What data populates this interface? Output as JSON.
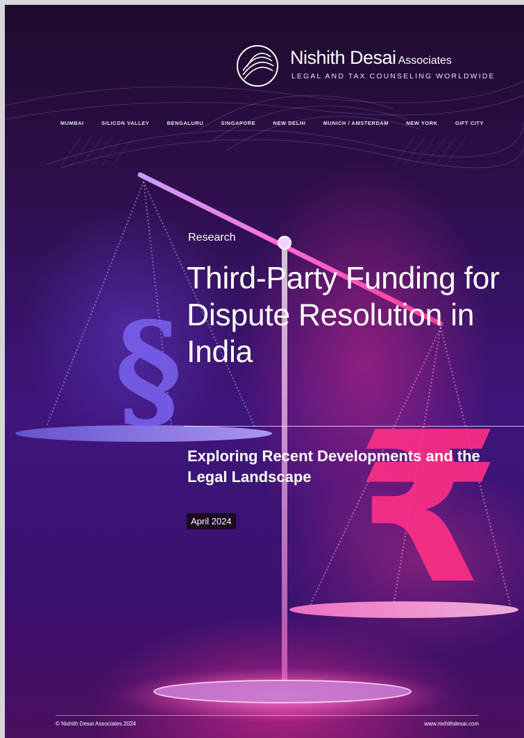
{
  "brand": {
    "name": "Nishith Desai",
    "name_suffix": "Associates",
    "tagline": "LEGAL AND TAX COUNSELING WORLDWIDE"
  },
  "offices": [
    "MUMBAI",
    "SILICON VALLEY",
    "BENGALURU",
    "SINGAPORE",
    "NEW DELHI",
    "MUNICH / AMSTERDAM",
    "NEW YORK",
    "GIFT CITY"
  ],
  "cover": {
    "category": "Research",
    "title": "Third-Party Funding for Dispute Resolution in India",
    "subtitle": "Exploring Recent Developments and the Legal Landscape",
    "date": "April 2024"
  },
  "footer": {
    "copyright": "© Nishith Desai Associates 2024",
    "website": "www.nishithdesai.com"
  },
  "artwork": {
    "left_symbol": "§",
    "right_symbol": "₹",
    "colors": {
      "left_symbol": "#7b63f0",
      "right_symbol": "#ff2f86",
      "beam": "#ff4fb0"
    }
  }
}
